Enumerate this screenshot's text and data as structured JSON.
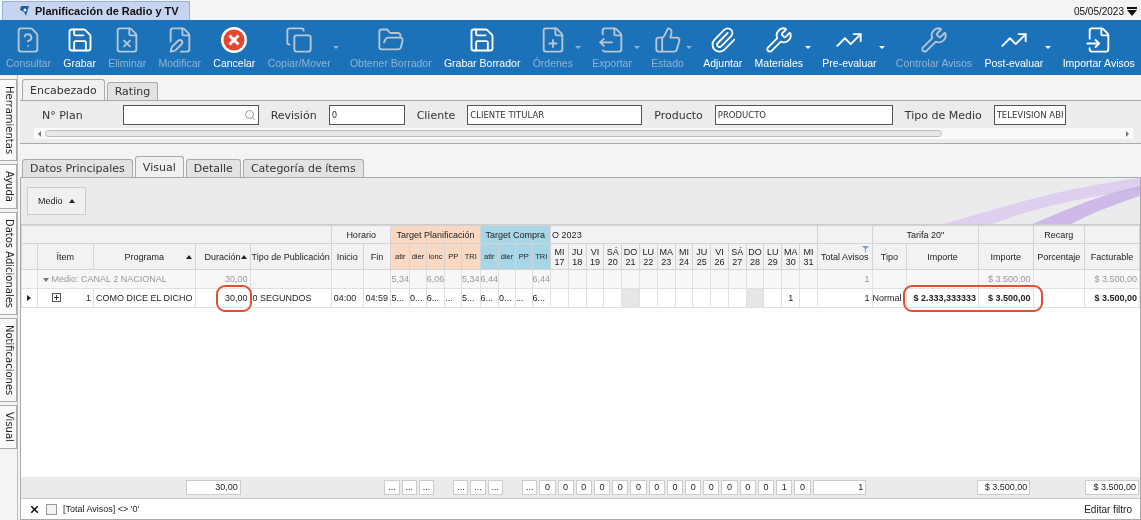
{
  "window": {
    "tab": "Planificación de Radio y TV",
    "date": "05/05/2023"
  },
  "toolbar": [
    {
      "label": "Consultar",
      "disabled": true,
      "dropdown": false
    },
    {
      "label": "Grabar",
      "disabled": false,
      "dropdown": false
    },
    {
      "label": "Eliminar",
      "disabled": true,
      "dropdown": false
    },
    {
      "label": "Modificar",
      "disabled": true,
      "dropdown": false
    },
    {
      "label": "Cancelar",
      "disabled": false,
      "dropdown": false
    },
    {
      "label": "Copiar/Mover",
      "disabled": true,
      "dropdown": true
    },
    {
      "label": "Obtener Borrador",
      "disabled": true,
      "dropdown": false
    },
    {
      "label": "Grabar Borrador",
      "disabled": false,
      "dropdown": false
    },
    {
      "label": "Órdenes",
      "disabled": true,
      "dropdown": true
    },
    {
      "label": "Exportar",
      "disabled": true,
      "dropdown": true
    },
    {
      "label": "Estado",
      "disabled": true,
      "dropdown": true
    },
    {
      "label": "Adjuntar",
      "disabled": false,
      "dropdown": false
    },
    {
      "label": "Materiales",
      "disabled": false,
      "dropdown": true
    },
    {
      "label": "Pre-evaluar",
      "disabled": false,
      "dropdown": true
    },
    {
      "label": "Controlar Avisos",
      "disabled": true,
      "dropdown": false
    },
    {
      "label": "Post-evaluar",
      "disabled": false,
      "dropdown": true
    },
    {
      "label": "Importar Avisos",
      "disabled": false,
      "dropdown": false
    }
  ],
  "side_tabs": [
    "Herramientas",
    "Ayuda",
    "Datos Adicionales",
    "Notificaciones",
    "Visual"
  ],
  "header_tabs": [
    {
      "label": "Encabezado",
      "selected": true
    },
    {
      "label": "Rating",
      "selected": false
    }
  ],
  "header_fields": [
    {
      "label": "N° Plan",
      "kind": "search"
    },
    {
      "label": "Revisión",
      "value": "0",
      "kind": "text"
    },
    {
      "label": "Cliente",
      "value": "CLIENTE TITULAR",
      "kind": "text"
    },
    {
      "label": "Producto",
      "value": "PRODUCTO",
      "kind": "text"
    },
    {
      "label": "Tipo de Medio",
      "value": "TELEVISION ABI",
      "kind": "text"
    }
  ],
  "detail_tabs": [
    {
      "label": "Datos Principales",
      "selected": false
    },
    {
      "label": "Visual",
      "selected": true
    },
    {
      "label": "Detalle",
      "selected": false
    },
    {
      "label": "Categoría de ítems",
      "selected": false
    }
  ],
  "grid": {
    "group_chip": "Medio",
    "bands": [
      {
        "label": "Horario"
      },
      {
        "label": "Target Planificación",
        "color": "#f9d8c4"
      },
      {
        "label": "Target Compra",
        "color": "#a8d6e6"
      },
      {
        "label": "O 2023"
      },
      {
        "label": "Tarifa 20\""
      },
      {
        "label": "Recarg"
      }
    ],
    "columns": [
      {
        "label": "Ítem",
        "sorted": false
      },
      {
        "label": "Programa",
        "sorted": true
      },
      {
        "label": "Duración",
        "sorted": true
      },
      {
        "label": "Tipo de Publicación",
        "sorted": false
      },
      {
        "label": "Inicio",
        "sorted": false
      },
      {
        "label": "Fin",
        "sorted": false
      }
    ],
    "plan_columns": [
      "atir",
      "dier",
      "ionc",
      "PP",
      "TRI"
    ],
    "compra_columns": [
      "atir",
      "dier",
      "PP",
      "TRI"
    ],
    "days": [
      {
        "day": "MI",
        "num": "17",
        "weekend": false
      },
      {
        "day": "JU",
        "num": "18",
        "weekend": false
      },
      {
        "day": "VI",
        "num": "19",
        "weekend": false
      },
      {
        "day": "SÁ",
        "num": "20",
        "weekend": false
      },
      {
        "day": "DO",
        "num": "21",
        "weekend": true
      },
      {
        "day": "LU",
        "num": "22",
        "weekend": false
      },
      {
        "day": "MA",
        "num": "23",
        "weekend": false
      },
      {
        "day": "MI",
        "num": "24",
        "weekend": false
      },
      {
        "day": "JU",
        "num": "25",
        "weekend": false
      },
      {
        "day": "VI",
        "num": "26",
        "weekend": false
      },
      {
        "day": "SÁ",
        "num": "27",
        "weekend": false
      },
      {
        "day": "DO",
        "num": "28",
        "weekend": true
      },
      {
        "day": "LU",
        "num": "29",
        "weekend": false
      },
      {
        "day": "MA",
        "num": "30",
        "weekend": false
      },
      {
        "day": "MI",
        "num": "31",
        "weekend": false
      }
    ],
    "tail_columns": [
      {
        "label": "Total Avisos",
        "filter": true
      },
      {
        "label": "Tipo",
        "filter": false
      },
      {
        "label": "Importe",
        "filter": false
      },
      {
        "label": "Importe",
        "filter": false
      },
      {
        "label": "Porcentaje",
        "filter": false
      },
      {
        "label": "Facturable",
        "filter": false
      }
    ],
    "group_row": {
      "label": "Medio: CANAL 2 NACIONAL",
      "expanded": true,
      "duracion": "30,00",
      "plan": {
        "1": "5,34",
        "3": "6,06",
        "5": "5,34"
      },
      "compra": {
        "1": "6,44",
        "4": "6,44"
      },
      "total": "1",
      "importe_2": "$ 3.500,00",
      "facturable": "$ 3.500,00"
    },
    "rows": [
      {
        "item": "1",
        "expanded": false,
        "programa": "COMO DICE EL DICHO",
        "duracion": "30,00",
        "duracion_circled": true,
        "tipo_publicacion": "0 SEGUNDOS",
        "inicio": "04:00",
        "fin": "04:59",
        "plan": [
          "5...",
          "0...",
          "6...",
          "...",
          "5..."
        ],
        "compra": [
          "6...",
          "0...",
          "...",
          "6..."
        ],
        "days": {
          "14": "1"
        },
        "total": "1",
        "tipo": "Normal",
        "importe": "$ 2.333,333333",
        "importe_circled": true,
        "importe_2": "$ 3.500,00",
        "facturable": "$ 3.500,00"
      }
    ],
    "footer": {
      "duracion": "30,00",
      "plan": {
        "1": "...",
        "2": "...",
        "3": "...",
        "5": "..."
      },
      "compra": {
        "1": "...",
        "2": "...",
        "4": "..."
      },
      "days": [
        "0",
        "0",
        "0",
        "0",
        "0",
        "0",
        "0",
        "0",
        "0",
        "0",
        "0",
        "0",
        "0",
        "1",
        "0"
      ],
      "total": "1",
      "importe_2": "$ 3.500,00",
      "facturable": "$ 3.500,00"
    },
    "filter": {
      "text": "[Total Avisos] <> '0'",
      "enabled": false,
      "edit": "Editar filtro"
    }
  }
}
